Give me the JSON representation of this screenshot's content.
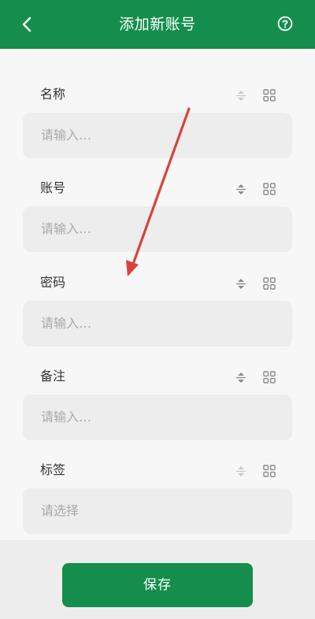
{
  "appbar": {
    "title": "添加新账号",
    "back_icon": "chevron-left-icon",
    "help_icon": "help-circle-icon",
    "color": "#158e4d"
  },
  "fields": [
    {
      "label": "名称",
      "placeholder": "请输入…",
      "sort_enabled": false
    },
    {
      "label": "账号",
      "placeholder": "请输入…",
      "sort_enabled": true
    },
    {
      "label": "密码",
      "placeholder": "请输入…",
      "sort_enabled": true
    },
    {
      "label": "备注",
      "placeholder": "请输入…",
      "sort_enabled": true
    },
    {
      "label": "标签",
      "placeholder": "请选择",
      "sort_enabled": false
    }
  ],
  "footer": {
    "save_label": "保存"
  },
  "annotation": {
    "arrow_color": "#d9423b"
  }
}
